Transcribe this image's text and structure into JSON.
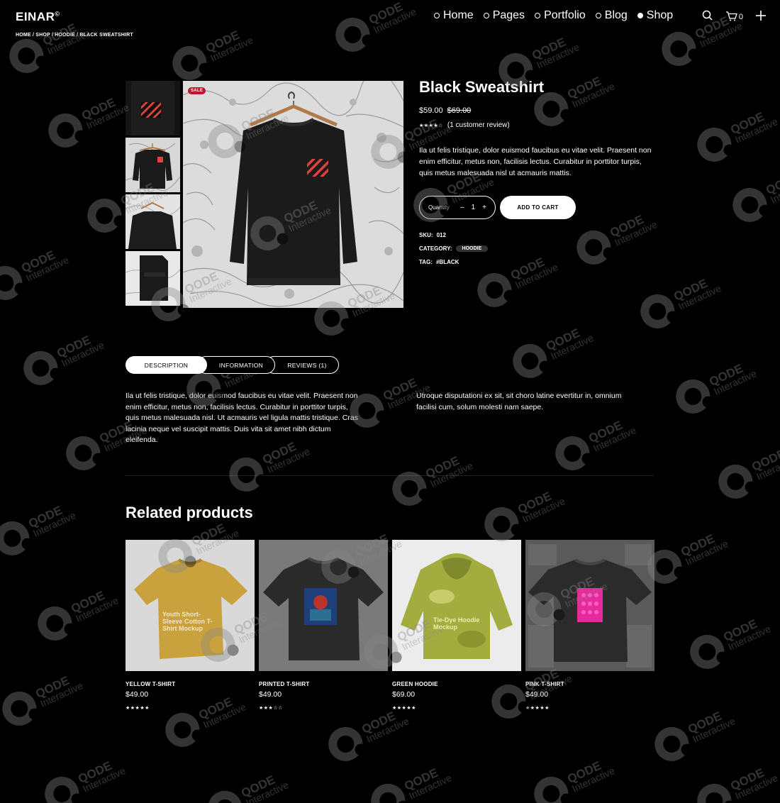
{
  "header": {
    "logo": "EINAR",
    "logo_mark": "©",
    "nav": [
      {
        "label": "Home",
        "active": false
      },
      {
        "label": "Pages",
        "active": false
      },
      {
        "label": "Portfolio",
        "active": false
      },
      {
        "label": "Blog",
        "active": false
      },
      {
        "label": "Shop",
        "active": true
      }
    ],
    "cart_count": "0",
    "icons": [
      "search-icon",
      "cart-icon",
      "plus-icon"
    ]
  },
  "breadcrumb": "HOME / SHOP / HOODIE / BLACK SWEATSHIRT",
  "product": {
    "badge": "SALE",
    "title": "Black Sweatshirt",
    "price": "$59.00",
    "old_price": "$69.00",
    "rating": 4,
    "rating_stars": "★★★★☆",
    "review_text": "(1 customer review)",
    "short_description": "Ila ut felis tristique, dolor euismod faucibus eu vitae velit. Praesent non enim efficitur, metus non, facilisis lectus. Curabitur in porttitor turpis, quis metus malesuada nisl ut acmauris mattis.",
    "quantity_label": "Quantity",
    "quantity_value": "1",
    "qty_minus": "–",
    "qty_plus": "+",
    "add_to_cart": "ADD TO CART",
    "sku_label": "SKU:",
    "sku": "012",
    "category_label": "CATEGORY:",
    "category": "HOODIE",
    "tag_label": "TAG:",
    "tag": "#BLACK"
  },
  "tabs": [
    {
      "label": "DESCRIPTION",
      "active": true
    },
    {
      "label": "INFORMATION",
      "active": false
    },
    {
      "label": "REVIEWS (1)",
      "active": false
    }
  ],
  "description": {
    "left": "Ila ut felis tristique, dolor euismod faucibus eu vitae velit. Praesent non enim efficitur, metus non, facilisis lectus. Curabitur in porttitor turpis, quis metus malesuada nisl. Ut acmauris vel ligula mattis tristique. Cras lacinia neque vel suscipit mattis. Duis vita sit amet nibh dictum eleifenda.",
    "right": "Utroque disputationi ex sit, sit choro latine evertitur in, omnium facilisi cum, solum molesti nam saepe."
  },
  "related": {
    "title": "Related products",
    "items": [
      {
        "name": "YELLOW T-SHIRT",
        "price": "$49.00",
        "stars": "★★★★★",
        "print_text": "Youth Short-Sleeve Cotton T-Shirt Mockup"
      },
      {
        "name": "PRINTED T-SHIRT",
        "price": "$49.00",
        "stars": "★★★☆☆"
      },
      {
        "name": "GREEN HOODIE",
        "price": "$69.00",
        "stars": "★★★★★",
        "print_text": "Tie-Dye Hoodie Mockup"
      },
      {
        "name": "PINK T-SHIRT",
        "price": "$49.00",
        "stars": "★★★★★"
      }
    ]
  },
  "watermark": {
    "brand": "QODE",
    "sub": "Interactive"
  },
  "colors": {
    "background": "#000000",
    "text": "#ffffff",
    "sale": "#c8102e",
    "watermark": "#888888"
  }
}
